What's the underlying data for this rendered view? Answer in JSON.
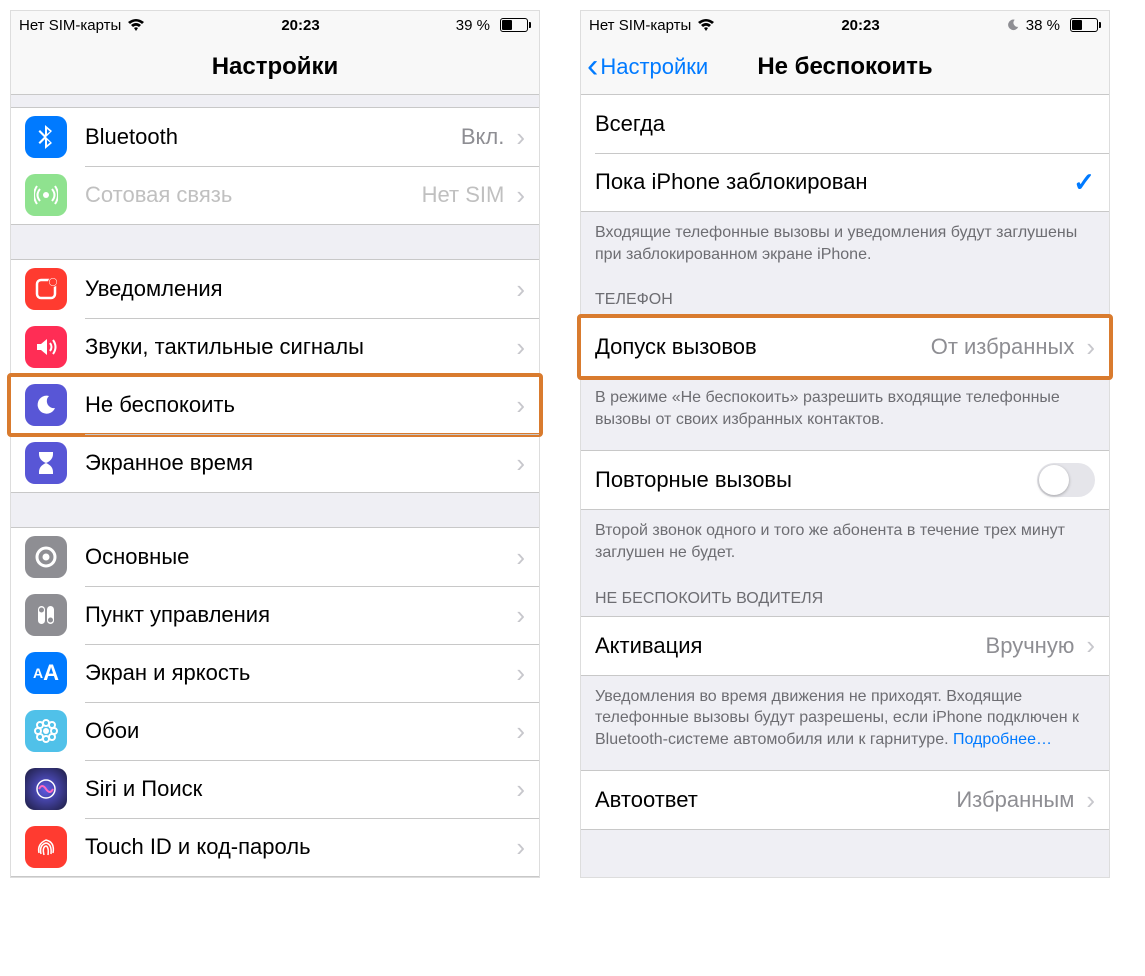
{
  "left": {
    "status": {
      "carrier": "Нет SIM-карты",
      "time": "20:23",
      "battery_pct": "39 %"
    },
    "nav": {
      "title": "Настройки"
    },
    "group1": [
      {
        "label": "Bluetooth",
        "detail": "Вкл.",
        "icon": "bluetooth",
        "color": "#007aff"
      },
      {
        "label": "Сотовая связь",
        "detail": "Нет SIM",
        "icon": "cellular",
        "color": "#8fe28f",
        "disabled": true
      }
    ],
    "group2": [
      {
        "label": "Уведомления",
        "icon": "notifications",
        "color": "#ff3b30"
      },
      {
        "label": "Звуки, тактильные сигналы",
        "icon": "sounds",
        "color": "#ff2d55"
      },
      {
        "label": "Не беспокоить",
        "icon": "dnd",
        "color": "#5856d6",
        "highlight": true
      },
      {
        "label": "Экранное время",
        "icon": "screentime",
        "color": "#5856d6"
      }
    ],
    "group3": [
      {
        "label": "Основные",
        "icon": "general",
        "color": "#8e8e93"
      },
      {
        "label": "Пункт управления",
        "icon": "control",
        "color": "#8e8e93"
      },
      {
        "label": "Экран и яркость",
        "icon": "display",
        "color": "#007aff"
      },
      {
        "label": "Обои",
        "icon": "wallpaper",
        "color": "#50c1e9"
      },
      {
        "label": "Siri и Поиск",
        "icon": "siri",
        "color": "#1c1c1e"
      },
      {
        "label": "Touch ID и код-пароль",
        "icon": "touchid",
        "color": "#ff3b30"
      }
    ]
  },
  "right": {
    "status": {
      "carrier": "Нет SIM-карты",
      "time": "20:23",
      "battery_pct": "38 %"
    },
    "nav": {
      "back": "Настройки",
      "title": "Не беспокоить"
    },
    "silence": {
      "options": [
        "Всегда",
        "Пока iPhone заблокирован"
      ],
      "selected": 1,
      "footer": "Входящие телефонные вызовы и уведомления будут заглушены при заблокированном экране iPhone."
    },
    "phone": {
      "header": "ТЕЛЕФОН",
      "allow_calls": {
        "label": "Допуск вызовов",
        "detail": "От избранных",
        "highlight": true
      },
      "allow_calls_footer": "В режиме «Не беспокоить» разрешить входящие телефонные вызовы от своих избранных контактов.",
      "repeated": {
        "label": "Повторные вызовы",
        "on": false
      },
      "repeated_footer": "Второй звонок одного и того же абонента в течение трех минут заглушен не будет."
    },
    "driving": {
      "header": "НЕ БЕСПОКОИТЬ ВОДИТЕЛЯ",
      "activate": {
        "label": "Активация",
        "detail": "Вручную"
      },
      "activate_footer": "Уведомления во время движения не приходят. Входящие телефонные вызовы будут разрешены, если iPhone подключен к Bluetooth-системе автомобиля или к гарнитуре. ",
      "activate_link": "Подробнее…",
      "autoreply": {
        "label": "Автоответ",
        "detail": "Избранным"
      }
    }
  }
}
